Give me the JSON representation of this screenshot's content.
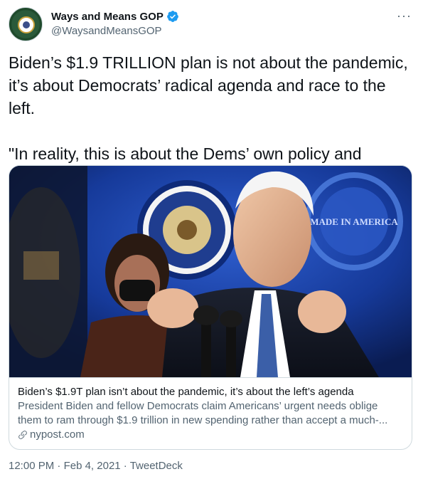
{
  "author": {
    "display_name": "Ways and Means GOP",
    "handle": "@WaysandMeansGOP",
    "verified": true
  },
  "tweet": {
    "paragraph1": "Biden’s $1.9 TRILLION plan is not about the pandemic, it’s about Democrats’ radical agenda and race to the left.",
    "paragraph2": "\"In reality, this is about the Dems’ own policy and patronage goals.\""
  },
  "card": {
    "title": "Biden’s $1.9T plan isn’t about the pandemic, it’s about the left’s agenda",
    "description": "President Biden and fellow Democrats claim Americans’ urgent needs oblige them to ram through $1.9 trillion in new spending rather than accept a much-...",
    "domain": "nypost.com",
    "image_seal_text": "MADE IN AMERICA"
  },
  "meta": {
    "time": "12:00 PM",
    "separator": "·",
    "date": "Feb 4, 2021",
    "source": "TweetDeck"
  },
  "colors": {
    "verified_blue": "#1d9bf0",
    "text_primary": "#0f1419",
    "text_secondary": "#536471",
    "border": "#cfd9de"
  },
  "icons": {
    "verified": "verified-badge-icon",
    "more": "more-icon",
    "link": "link-icon"
  }
}
